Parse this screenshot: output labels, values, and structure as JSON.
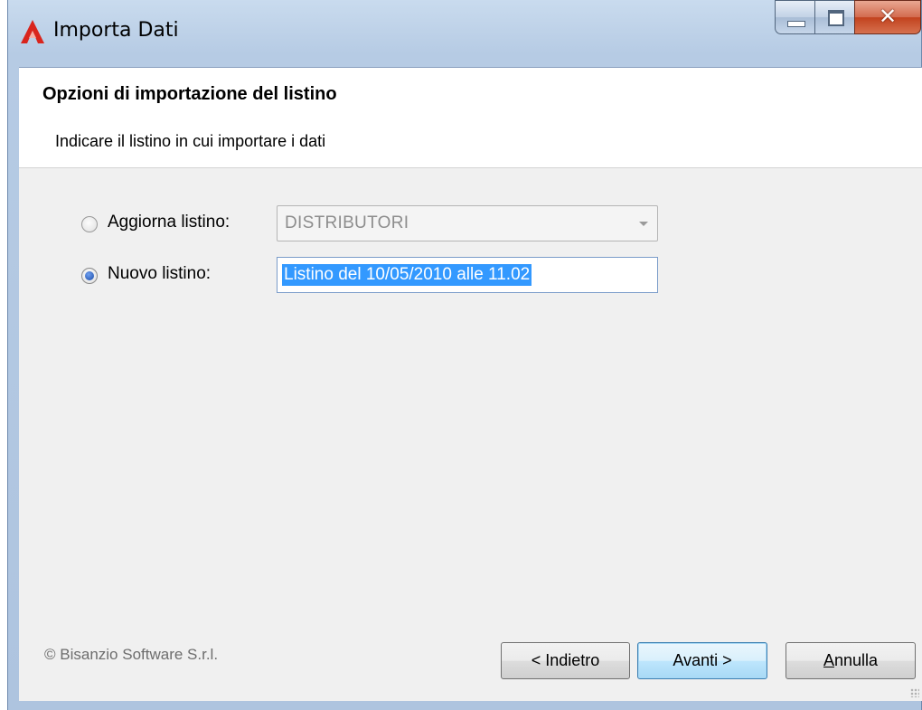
{
  "window": {
    "title": "Importa Dati",
    "accent_color": "#d9251d"
  },
  "header": {
    "title": "Opzioni di importazione del listino",
    "subtitle": "Indicare il listino in cui importare i dati"
  },
  "options": {
    "update": {
      "label": "Aggiorna listino:",
      "selected": false,
      "combo_value": "DISTRIBUTORI",
      "combo_enabled": false
    },
    "new": {
      "label": "Nuovo listino:",
      "selected": true,
      "input_value": "Listino del 10/05/2010 alle 11.02"
    }
  },
  "footer": {
    "copyright": "© Bisanzio Software S.r.l."
  },
  "buttons": {
    "back": "< Indietro",
    "next": "Avanti >",
    "cancel_first": "A",
    "cancel_rest": "nnulla"
  },
  "icons": {
    "app": "app-logo-icon",
    "minimize": "minimize-icon",
    "maximize": "maximize-icon",
    "close": "close-icon",
    "dropdown": "chevron-down-icon",
    "grip": "resize-grip-icon"
  }
}
